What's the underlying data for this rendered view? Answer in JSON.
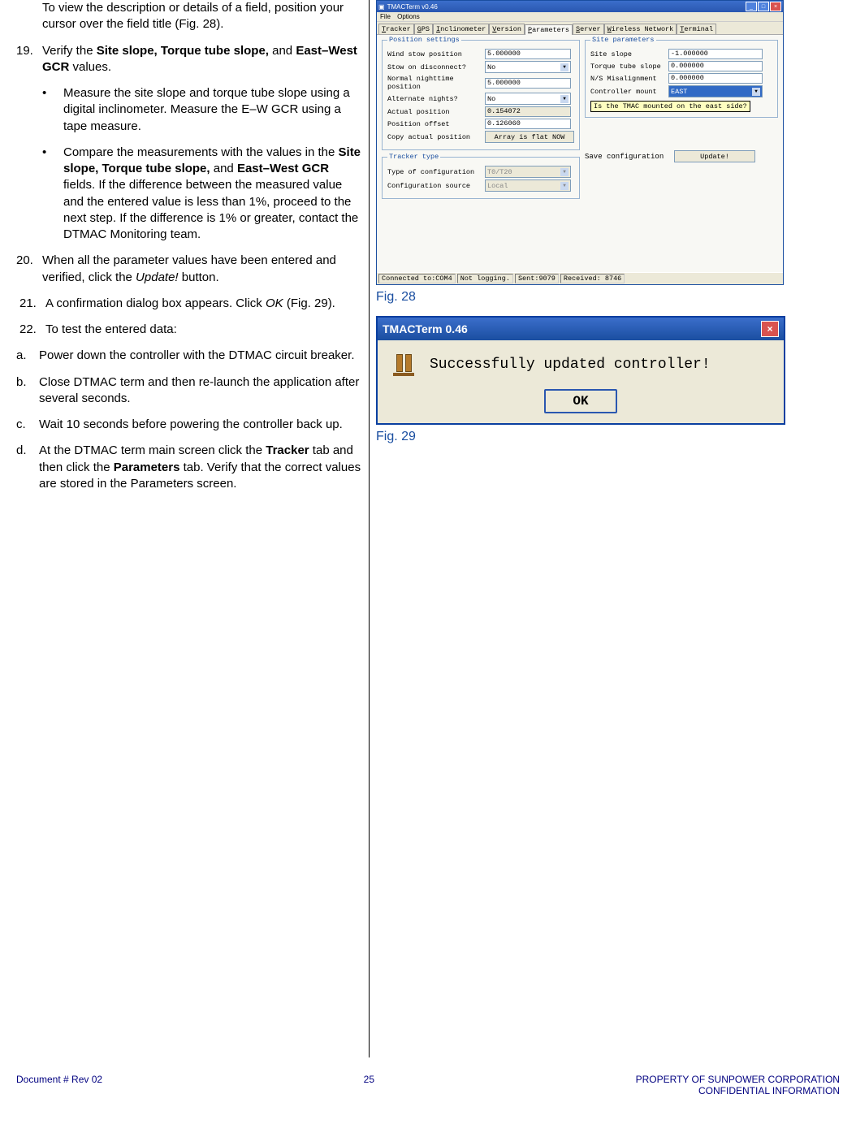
{
  "text": {
    "intro": "To view the description or details of a field, position your cursor over the field title (Fig. 28).",
    "item19_pre": "Verify the ",
    "item19_b1": "Site slope, Torque tube slope,",
    "item19_mid": " and ",
    "item19_b2": "East–West GCR",
    "item19_post": " values.",
    "bullet1": "Measure the site slope and torque tube slope using a digital inclinometer. Measure the E–W GCR using a tape measure.",
    "bullet2_pre": "Compare the measurements with the values in the ",
    "bullet2_b1": "Site slope, Torque tube slope,",
    "bullet2_mid": " and ",
    "bullet2_b2": "East–West GCR",
    "bullet2_post": " fields. If the difference between the measured value and the entered value is less than 1%, proceed to the next step. If the difference is 1% or greater, contact the DTMAC Monitoring team.",
    "item20_pre": "When all the parameter values have been entered and verified, click the ",
    "item20_i": "Update!",
    "item20_post": " button.",
    "item21_pre": "A confirmation dialog box appears. Click ",
    "item21_i": "OK",
    "item21_post": " (Fig. 29).",
    "item22": "To test the entered data:",
    "a": "Power down the controller with the DTMAC circuit breaker.",
    "b": "Close DTMAC term and then re-launch the application after several seconds.",
    "c": "Wait 10 seconds before powering the controller back up.",
    "d_pre": "At the DTMAC term main screen click the ",
    "d_b1": "Tracker",
    "d_mid": " tab and then click the ",
    "d_b2": "Parameters",
    "d_post": " tab. Verify that the correct values are stored in the Parameters screen."
  },
  "nums": {
    "n19": "19.",
    "n20": "20.",
    "n21": "21.",
    "n22": "22.",
    "a": "a.",
    "b": "b.",
    "c": "c.",
    "d": "d."
  },
  "fig28": {
    "caption": "Fig. 28",
    "title": "TMACTerm v0.46",
    "menu_file": "File",
    "menu_options": "Options",
    "tabs": [
      "Tracker",
      "GPS",
      "Inclinometer",
      "Version",
      "Parameters",
      "Server",
      "Wireless Network",
      "Terminal"
    ],
    "active_tab": 4,
    "group_pos": "Position settings",
    "pos_rows": [
      {
        "label": "Wind stow position",
        "value": "5.000000",
        "type": "text"
      },
      {
        "label": "Stow on disconnect?",
        "value": "No",
        "type": "select"
      },
      {
        "label": "Normal nighttime position",
        "value": "5.000000",
        "type": "text"
      },
      {
        "label": "Alternate nights?",
        "value": "No",
        "type": "select"
      },
      {
        "label": "Actual position",
        "value": "0.154072",
        "type": "ro"
      },
      {
        "label": "Position offset",
        "value": "0.126060",
        "type": "text"
      }
    ],
    "copy_label": "Copy actual position",
    "copy_btn": "Array is flat NOW",
    "group_type": "Tracker type",
    "type_rows": [
      {
        "label": "Type of configuration",
        "value": "T0/T20"
      },
      {
        "label": "Configuration source",
        "value": "Local"
      }
    ],
    "group_site": "Site parameters",
    "site_rows": [
      {
        "label": "Site slope",
        "value": "-1.000000",
        "type": "text"
      },
      {
        "label": "Torque tube slope",
        "value": "0.000000",
        "type": "text"
      },
      {
        "label": "N/S Misalignment",
        "value": "0.000000",
        "type": "text"
      },
      {
        "label": "Controller mount",
        "value": "EAST",
        "type": "select-hl"
      }
    ],
    "tooltip": "Is the TMAC mounted on the east side?",
    "save_label": "Save configuration",
    "update_btn": "Update!",
    "status": [
      "Connected to:COM4",
      "Not logging.",
      "Sent:9079",
      "Received: 8746"
    ]
  },
  "fig29": {
    "caption": "Fig. 29",
    "title": "TMACTerm 0.46",
    "msg": "Successfully updated controller!",
    "ok": "OK"
  },
  "footer": {
    "left": "Document # Rev 02",
    "center": "25",
    "right1": "PROPERTY OF SUNPOWER CORPORATION",
    "right2": "CONFIDENTIAL INFORMATION"
  }
}
